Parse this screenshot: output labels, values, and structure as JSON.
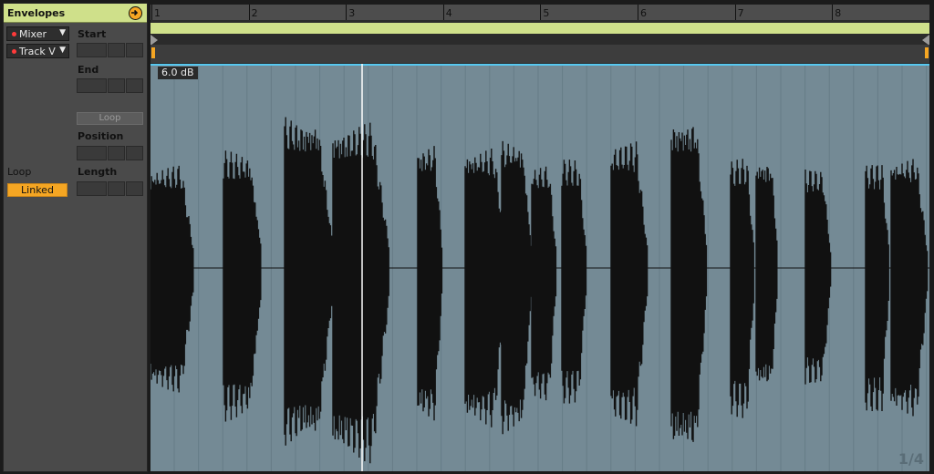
{
  "envelopes": {
    "title": "Envelopes",
    "device_chooser": "Mixer",
    "control_chooser": "Track V",
    "dropdown_arrow": "▼"
  },
  "sample_fields": {
    "start_label": "Start",
    "end_label": "End",
    "loop_button": "Loop",
    "position_label": "Position",
    "length_label": "Length"
  },
  "loop_section": {
    "label": "Loop",
    "linked_button": "Linked"
  },
  "ruler": {
    "bars": [
      "1",
      "2",
      "3",
      "4",
      "5",
      "6",
      "7",
      "8"
    ]
  },
  "sample_display": {
    "gain_label": "6.0 dB",
    "page_indicator": "1/4"
  },
  "colors": {
    "accent_orange": "#f5a623",
    "loop_green": "#cfe08a",
    "sample_bg": "#748a95",
    "waveform": "#111111",
    "playhead": "#ffffff",
    "envelope_line": "#57c8f0"
  }
}
